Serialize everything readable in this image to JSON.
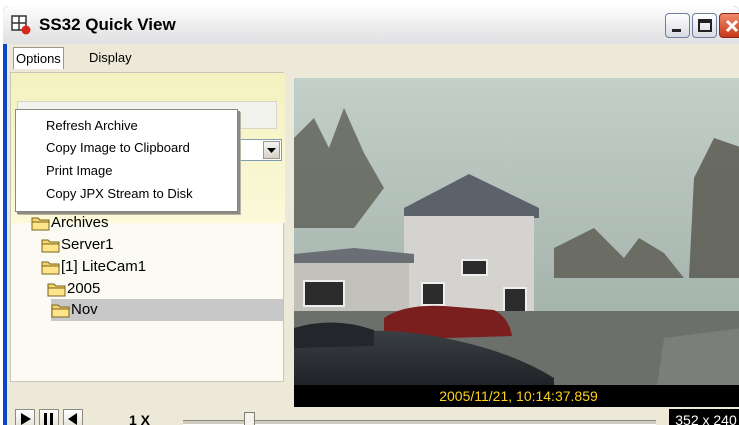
{
  "window": {
    "title": "SS32 Quick View"
  },
  "menubar": {
    "items": [
      {
        "label": "Options",
        "open": true
      },
      {
        "label": "Display",
        "open": false
      }
    ]
  },
  "options_menu": {
    "items": [
      "Refresh Archive",
      "Copy Image to Clipboard",
      "Print Image",
      "Copy JPX Stream to Disk"
    ]
  },
  "tree": {
    "nodes": [
      {
        "label": "Archives",
        "selected": false
      },
      {
        "label": "Server1",
        "selected": false
      },
      {
        "label": "[1] LiteCam1",
        "selected": false
      },
      {
        "label": "2005",
        "selected": false
      },
      {
        "label": "Nov",
        "selected": true
      }
    ]
  },
  "video": {
    "timestamp": "2005/11/21, 10:14:37.859"
  },
  "playback": {
    "speed_label": "1 X",
    "resolution": "352 x 240",
    "position_fraction": 0.14
  },
  "colors": {
    "timestamp_text": "#ffd21a",
    "selection_bg": "#c9c8c8",
    "window_accent": "#0a46c8"
  },
  "icons": [
    "app-grid-icon",
    "minimize-icon",
    "maximize-icon",
    "close-icon",
    "folder-icon",
    "play-icon",
    "pause-icon",
    "step-back-icon",
    "dropdown-arrow-icon"
  ]
}
